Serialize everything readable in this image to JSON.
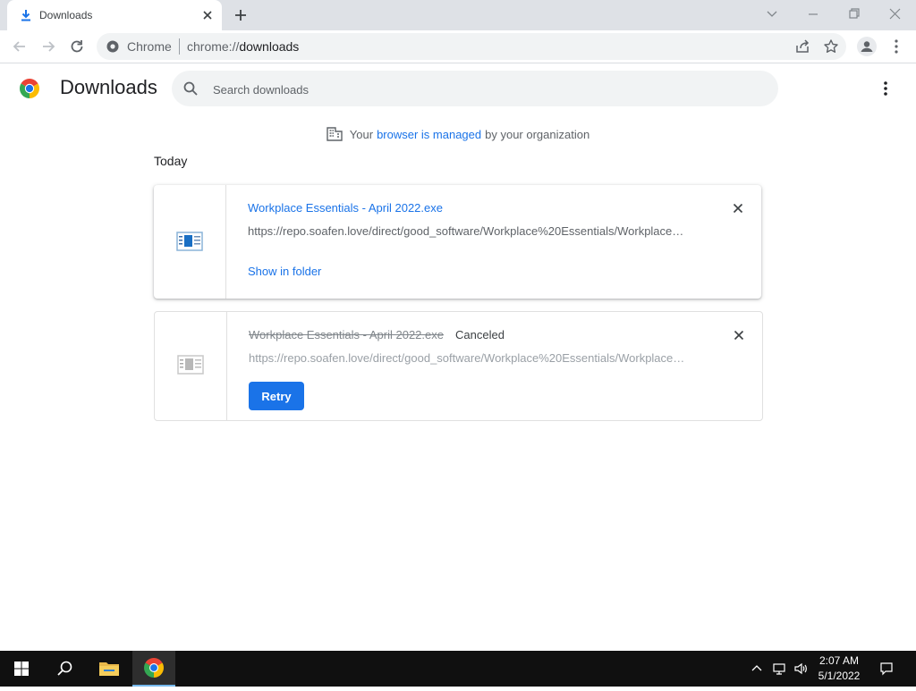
{
  "tab": {
    "title": "Downloads"
  },
  "omnibox": {
    "site_label": "Chrome",
    "url_scheme": "chrome://",
    "url_path": "downloads"
  },
  "page": {
    "title": "Downloads",
    "search_placeholder": "Search downloads"
  },
  "managed": {
    "prefix": "Your",
    "link": "browser is managed",
    "suffix": "by your organization"
  },
  "section_date": "Today",
  "downloads": [
    {
      "filename": "Workplace Essentials - April 2022.exe",
      "url": "https://repo.soafen.love/direct/good_software/Workplace%20Essentials/Workplace…",
      "action": "Show in folder"
    },
    {
      "filename": "Workplace Essentials - April 2022.exe",
      "status": "Canceled",
      "url": "https://repo.soafen.love/direct/good_software/Workplace%20Essentials/Workplace…",
      "action": "Retry"
    }
  ],
  "taskbar": {
    "time": "2:07 AM",
    "date": "5/1/2022"
  },
  "colors": {
    "accent": "#1a73e8",
    "tabstrip": "#dee1e6",
    "taskbar": "#101010"
  },
  "icons": [
    "download-icon",
    "close-icon",
    "new-tab-icon",
    "minimize-icon",
    "maximize-icon",
    "search-icon",
    "building-icon",
    "star-icon",
    "share-icon",
    "profile-icon",
    "more-vert-icon",
    "windows-start-icon",
    "folder-icon",
    "chrome-logo-icon"
  ]
}
